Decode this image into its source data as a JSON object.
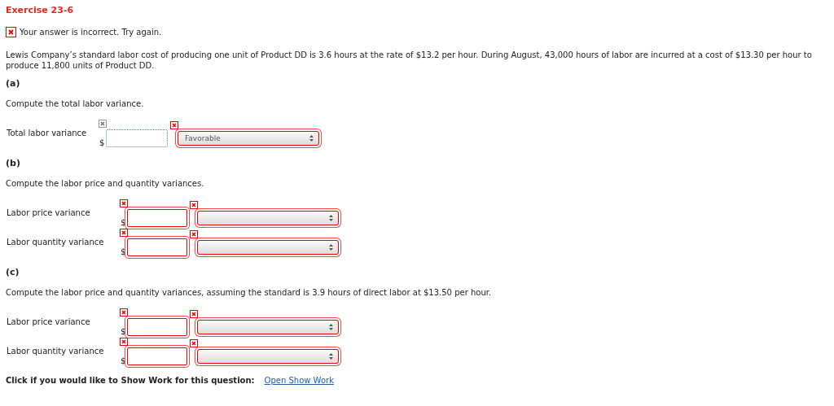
{
  "title": "Exercise 23-6",
  "feedback": {
    "incorrect": true,
    "text": "Your answer is incorrect.  Try again."
  },
  "problem": "Lewis Company’s standard labor cost of producing one unit of Product DD is 3.6 hours at the rate of $13.2 per hour. During August, 43,000 hours of labor are incurred at a cost of $13.30 per hour to produce 11,800 units of Product DD.",
  "sections": [
    {
      "heading": "(a)",
      "instruction": "Compute the total labor variance.",
      "rows": [
        {
          "label": "Total labor variance",
          "currency": "$",
          "amount_incorrect": false,
          "select_incorrect": true,
          "select_value": "Favorable"
        }
      ]
    },
    {
      "heading": "(b)",
      "instruction": "Compute the labor price and quantity variances.",
      "rows": [
        {
          "label": "Labor price variance",
          "currency": "$",
          "amount_incorrect": true,
          "select_incorrect": true
        },
        {
          "label": "Labor quantity variance",
          "currency": "$",
          "amount_incorrect": true,
          "select_incorrect": true
        }
      ]
    },
    {
      "heading": "(c)",
      "instruction": "Compute the labor price and quantity variances, assuming the standard is 3.9 hours of direct labor at $13.50 per hour.",
      "rows": [
        {
          "label": "Labor price variance",
          "currency": "$",
          "amount_incorrect": true,
          "select_incorrect": true
        },
        {
          "label": "Labor quantity variance",
          "currency": "$",
          "amount_incorrect": true,
          "select_incorrect": true
        }
      ]
    }
  ],
  "footer": {
    "prompt": "Click if you would like to Show Work for this question:",
    "link": "Open Show Work"
  }
}
